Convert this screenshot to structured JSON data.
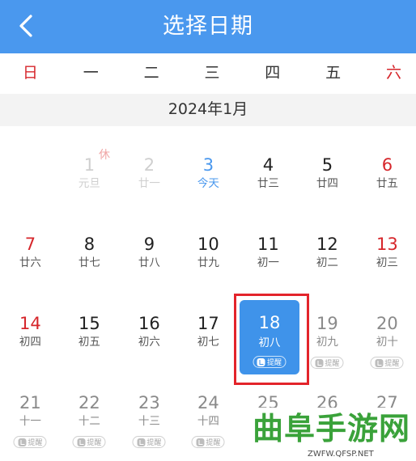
{
  "header": {
    "title": "选择日期"
  },
  "weekdays": [
    "日",
    "一",
    "二",
    "三",
    "四",
    "五",
    "六"
  ],
  "month_label": "2024年1月",
  "holiday_badge": "休",
  "remind_label": "提醒",
  "days": [
    {
      "num": "1",
      "lunar": "元旦",
      "style": "faded"
    },
    {
      "num": "2",
      "lunar": "廿一",
      "style": "faded"
    },
    {
      "num": "3",
      "lunar": "今天",
      "style": "today"
    },
    {
      "num": "4",
      "lunar": "廿三",
      "style": "normal"
    },
    {
      "num": "5",
      "lunar": "廿四",
      "style": "normal"
    },
    {
      "num": "6",
      "lunar": "廿五",
      "style": "red"
    },
    {
      "num": "7",
      "lunar": "廿六",
      "style": "red"
    },
    {
      "num": "8",
      "lunar": "廿七",
      "style": "normal"
    },
    {
      "num": "9",
      "lunar": "廿八",
      "style": "normal"
    },
    {
      "num": "10",
      "lunar": "廿九",
      "style": "normal"
    },
    {
      "num": "11",
      "lunar": "初一",
      "style": "normal"
    },
    {
      "num": "12",
      "lunar": "初二",
      "style": "normal"
    },
    {
      "num": "13",
      "lunar": "初三",
      "style": "red"
    },
    {
      "num": "14",
      "lunar": "初四",
      "style": "red"
    },
    {
      "num": "15",
      "lunar": "初五",
      "style": "normal"
    },
    {
      "num": "16",
      "lunar": "初六",
      "style": "normal"
    },
    {
      "num": "17",
      "lunar": "初七",
      "style": "normal"
    },
    {
      "num": "18",
      "lunar": "初八",
      "style": "selected"
    },
    {
      "num": "19",
      "lunar": "初九",
      "style": "future"
    },
    {
      "num": "20",
      "lunar": "初十",
      "style": "future"
    },
    {
      "num": "21",
      "lunar": "十一",
      "style": "future"
    },
    {
      "num": "22",
      "lunar": "十二",
      "style": "future"
    },
    {
      "num": "23",
      "lunar": "十三",
      "style": "future"
    },
    {
      "num": "24",
      "lunar": "十四",
      "style": "future"
    },
    {
      "num": "25",
      "lunar": "",
      "style": "future"
    },
    {
      "num": "26",
      "lunar": "",
      "style": "future"
    },
    {
      "num": "27",
      "lunar": "",
      "style": "future"
    }
  ],
  "watermark": {
    "brand": "曲阜手游网",
    "url": "ZWFW.QFSP.NET"
  },
  "colors": {
    "header": "#4a98ee",
    "weekend_red": "#d6262b",
    "selected": "#3f93ea",
    "highlight": "#e3242b",
    "watermark_green": "#3aa23a"
  }
}
